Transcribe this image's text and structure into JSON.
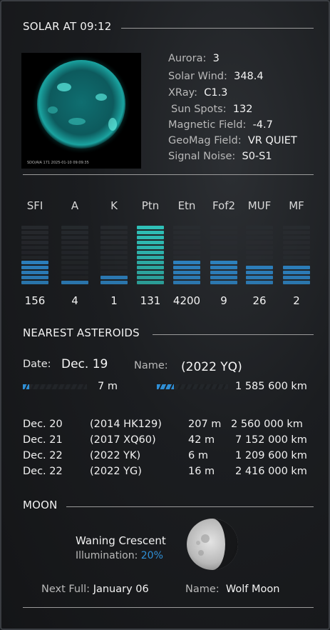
{
  "solar": {
    "title": "SOLAR AT 09:12",
    "image_caption": "SDO/AIA 171 2025-01-10 09:09:35",
    "fields": [
      {
        "label": "Aurora:",
        "value": "3"
      },
      {
        "label": "Solar Wind:",
        "value": "348.4"
      },
      {
        "label": "XRay:",
        "value": "C1.3"
      },
      {
        "label": "Sun Spots:",
        "value": "132"
      },
      {
        "label": "Magnetic Field:",
        "value": "-4.7"
      },
      {
        "label": "GeoMag Field:",
        "value": "VR QUIET"
      },
      {
        "label": "Signal Noise:",
        "value": "S0-S1"
      }
    ]
  },
  "bands": {
    "columns": [
      {
        "label": "SFI",
        "value": "156",
        "level": 0.45,
        "color": "blue"
      },
      {
        "label": "A",
        "value": "4",
        "level": 0.08,
        "color": "blue"
      },
      {
        "label": "K",
        "value": "1",
        "level": 0.18,
        "color": "blue"
      },
      {
        "label": "Ptn",
        "value": "131",
        "level": 1.0,
        "color": "teal"
      },
      {
        "label": "Etn",
        "value": "4200",
        "level": 0.45,
        "color": "blue"
      },
      {
        "label": "Fof2",
        "value": "9",
        "level": 0.45,
        "color": "blue"
      },
      {
        "label": "MUF",
        "value": "26",
        "level": 0.3,
        "color": "blue"
      },
      {
        "label": "MF",
        "value": "2",
        "level": 0.3,
        "color": "blue"
      }
    ],
    "colors": {
      "blue": "#2f8fd6",
      "teal": "#2fc0b8",
      "empty": "#2a2d31"
    }
  },
  "asteroids": {
    "title": "NEAREST ASTEROIDS",
    "date_label": "Date:",
    "date_value": "Dec. 19",
    "name_label": "Name:",
    "name_value": "(2022 YQ)",
    "size": "7 m",
    "distance": "1 585 600 km",
    "list": [
      {
        "date": "Dec. 20",
        "name": "(2014 HK129)",
        "size": "207 m",
        "distance": "2 560 000 km",
        "size_color": "blue",
        "dist_color": "teal"
      },
      {
        "date": "Dec. 21",
        "name": "(2017 XQ60)",
        "size": "42 m",
        "distance": "7 152 000 km",
        "size_color": "teal",
        "dist_color": "blue"
      },
      {
        "date": "Dec. 22",
        "name": "(2022 YK)",
        "size": "6 m",
        "distance": "1 209 600 km",
        "size_color": "blue",
        "dist_color": "teal"
      },
      {
        "date": "Dec. 22",
        "name": "(2022 YG)",
        "size": "16 m",
        "distance": "2 416 000 km",
        "size_color": "teal",
        "dist_color": "blue"
      }
    ]
  },
  "moon": {
    "title": "MOON",
    "phase": "Waning Crescent",
    "illumination_label": "Illumination:",
    "illumination_value": "20%",
    "illumination": 0.2,
    "next_full_label": "Next Full:",
    "next_full_value": "January 06",
    "name_label": "Name:",
    "name_value": "Wolf Moon"
  }
}
